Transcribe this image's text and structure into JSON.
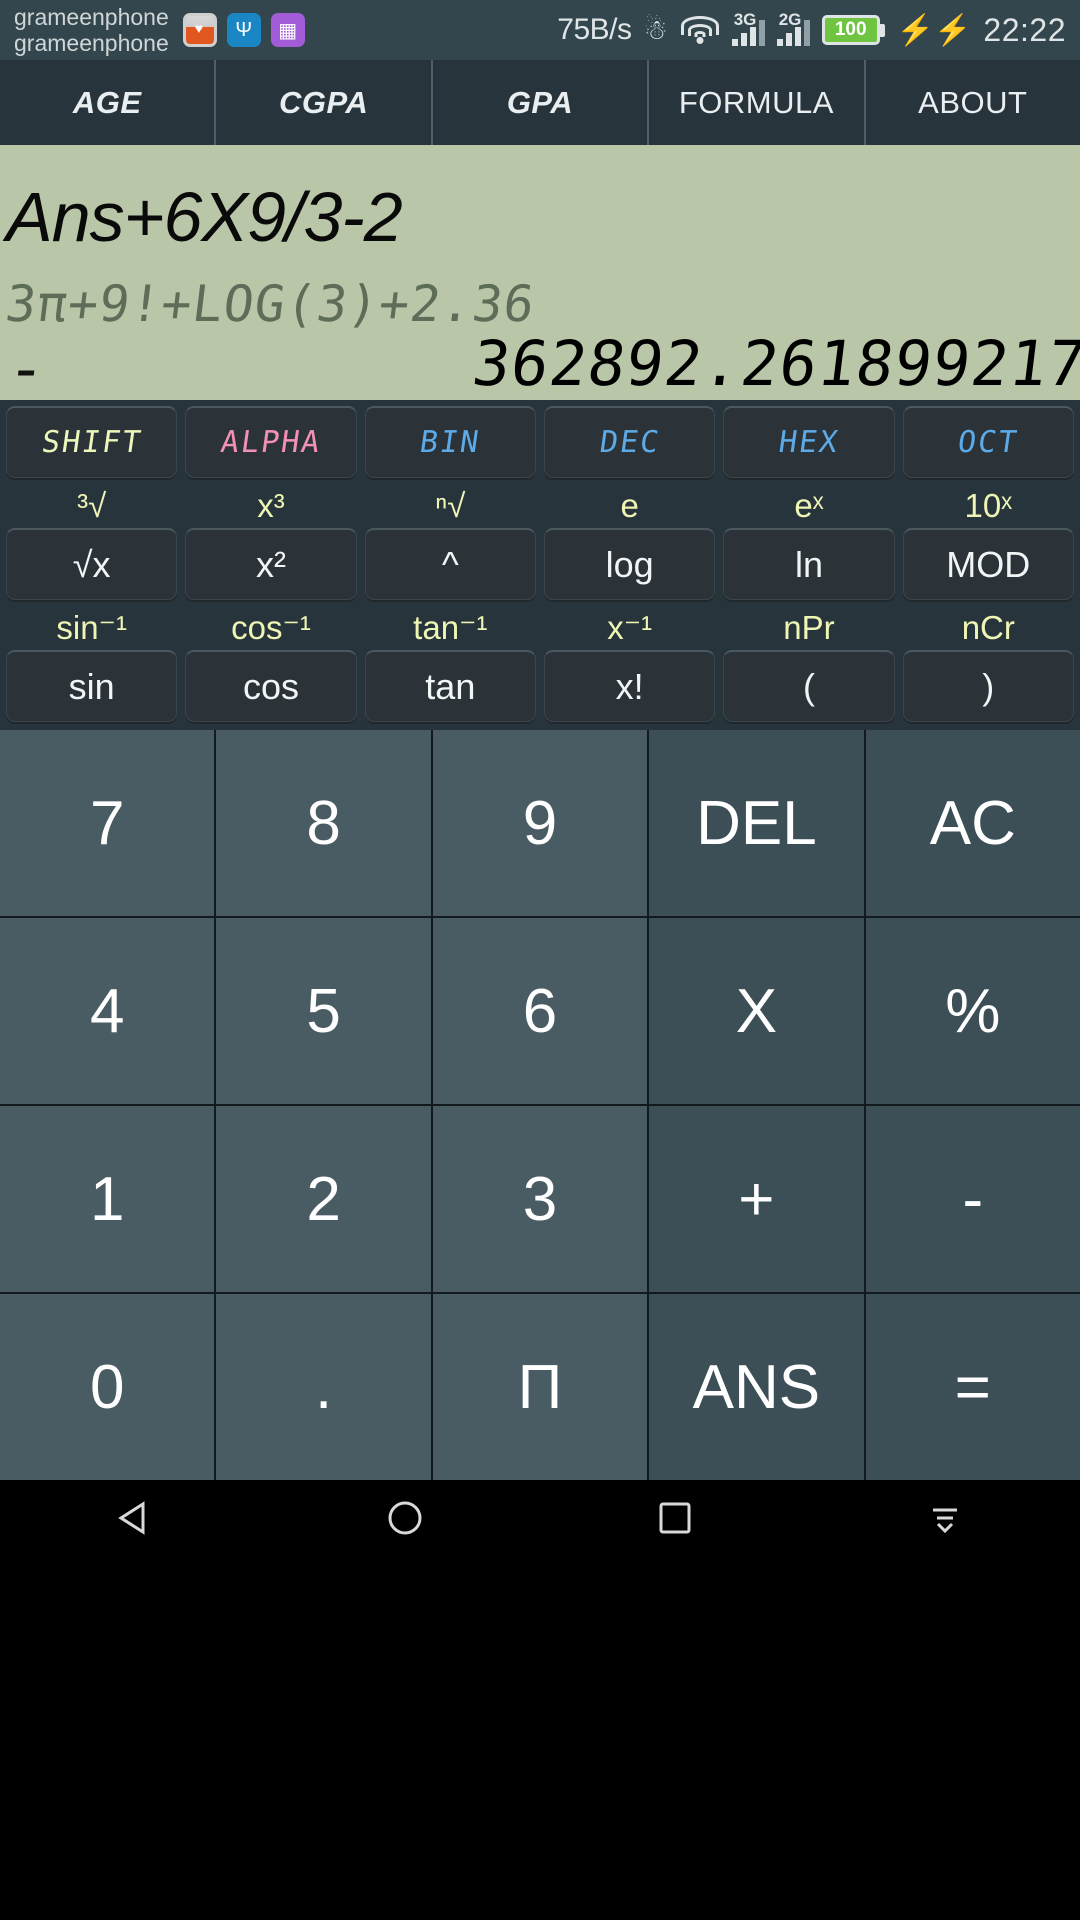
{
  "statusbar": {
    "carrier_line1": "grameenphone",
    "carrier_line2": "grameenphone",
    "icons": [
      "gallery-icon",
      "usb-icon",
      "screenshot-icon"
    ],
    "net_speed": "75B/s",
    "vibrate": "vibrate-icon",
    "wifi": "wifi-icon",
    "sim1_label": "3G",
    "sim2_label": "2G",
    "battery_percent": "100",
    "charging": "charging-bolt-icon",
    "time": "22:22"
  },
  "tabs": [
    {
      "label": "AGE",
      "emphasis": true
    },
    {
      "label": "CGPA",
      "emphasis": true
    },
    {
      "label": "GPA",
      "emphasis": true
    },
    {
      "label": "FORMULA",
      "emphasis": false
    },
    {
      "label": "ABOUT",
      "emphasis": false
    }
  ],
  "display": {
    "expression": "Ans+6X9/3-2",
    "previous": "3π+9!+LOG(3)+2.36",
    "sign": "-",
    "result": "362892.261899217",
    "bg_color": "#b9c6a8"
  },
  "sci_rows": [
    {
      "style": "lcd",
      "keys": [
        {
          "sup": "",
          "label": "SHIFT",
          "color": "#eef7bb"
        },
        {
          "sup": "",
          "label": "ALPHA",
          "color": "#f291b6"
        },
        {
          "sup": "",
          "label": "BIN",
          "color": "#5cabe8"
        },
        {
          "sup": "",
          "label": "DEC",
          "color": "#5cabe8"
        },
        {
          "sup": "",
          "label": "HEX",
          "color": "#5cabe8"
        },
        {
          "sup": "",
          "label": "OCT",
          "color": "#5cabe8"
        }
      ]
    },
    {
      "style": "plain",
      "keys": [
        {
          "sup": "³√",
          "label": "√x"
        },
        {
          "sup": "x³",
          "label": "x²"
        },
        {
          "sup": "ⁿ√",
          "label": "^"
        },
        {
          "sup": "e",
          "label": "log"
        },
        {
          "sup": "eˣ",
          "label": "ln"
        },
        {
          "sup": "10ˣ",
          "label": "MOD"
        }
      ]
    },
    {
      "style": "plain",
      "keys": [
        {
          "sup": "sin⁻¹",
          "label": "sin"
        },
        {
          "sup": "cos⁻¹",
          "label": "cos"
        },
        {
          "sup": "tan⁻¹",
          "label": "tan"
        },
        {
          "sup": "x⁻¹",
          "label": "x!"
        },
        {
          "sup": "nPr",
          "label": "("
        },
        {
          "sup": "nCr",
          "label": ")"
        }
      ]
    }
  ],
  "numpad": [
    [
      {
        "label": "7",
        "op": false
      },
      {
        "label": "8",
        "op": false
      },
      {
        "label": "9",
        "op": false
      },
      {
        "label": "DEL",
        "op": true
      },
      {
        "label": "AC",
        "op": true
      }
    ],
    [
      {
        "label": "4",
        "op": false
      },
      {
        "label": "5",
        "op": false
      },
      {
        "label": "6",
        "op": false
      },
      {
        "label": "X",
        "op": true
      },
      {
        "label": "%",
        "op": true
      }
    ],
    [
      {
        "label": "1",
        "op": false
      },
      {
        "label": "2",
        "op": false
      },
      {
        "label": "3",
        "op": false
      },
      {
        "label": "+",
        "op": true
      },
      {
        "label": "-",
        "op": true
      }
    ],
    [
      {
        "label": "0",
        "op": false
      },
      {
        "label": ".",
        "op": false
      },
      {
        "label": "Π",
        "op": false
      },
      {
        "label": "ANS",
        "op": true
      },
      {
        "label": "=",
        "op": true
      }
    ]
  ],
  "navbar": {
    "back": "back-triangle-icon",
    "home": "home-circle-icon",
    "recents": "recents-square-icon",
    "hide": "hide-navbar-icon"
  }
}
